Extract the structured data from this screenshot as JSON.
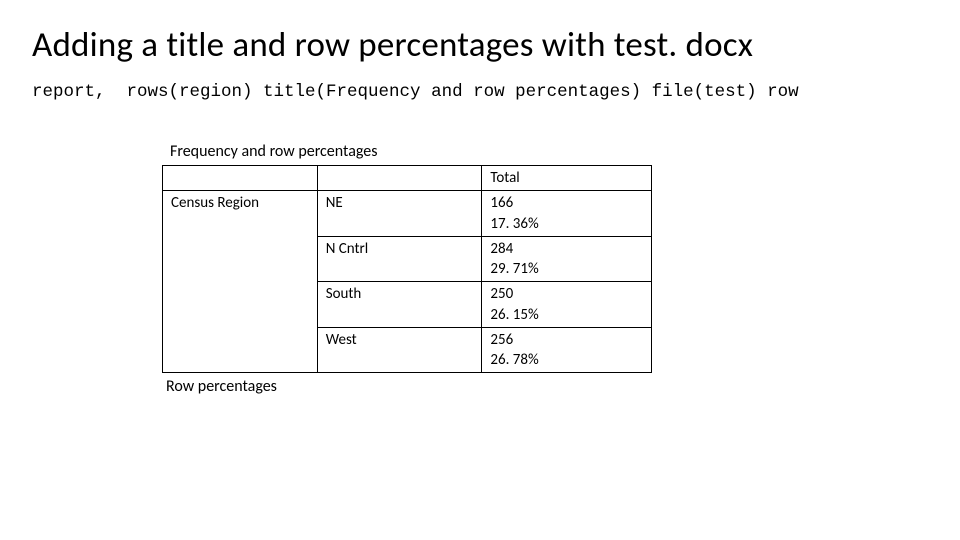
{
  "title": "Adding a title and row percentages with test. docx",
  "command": "report,  rows(region) title(Frequency and row percentages) file(test) row",
  "table": {
    "title": "Frequency and row percentages",
    "total_label": "Total",
    "row_header": "Census Region",
    "rows": [
      {
        "label": "NE",
        "count": "166",
        "pct": "17. 36%"
      },
      {
        "label": "N Cntrl",
        "count": "284",
        "pct": "29. 71%"
      },
      {
        "label": "South",
        "count": "250",
        "pct": "26. 15%"
      },
      {
        "label": "West",
        "count": "256",
        "pct": "26. 78%"
      }
    ],
    "footnote": "Row percentages"
  },
  "chart_data": {
    "type": "table",
    "title": "Frequency and row percentages",
    "row_variable": "Census Region",
    "columns": [
      "Total",
      "Row %"
    ],
    "categories": [
      "NE",
      "N Cntrl",
      "South",
      "West"
    ],
    "series": [
      {
        "name": "Total",
        "values": [
          166,
          284,
          250,
          256
        ]
      },
      {
        "name": "Row %",
        "values": [
          17.36,
          29.71,
          26.15,
          26.78
        ]
      }
    ],
    "note": "Row percentages"
  }
}
